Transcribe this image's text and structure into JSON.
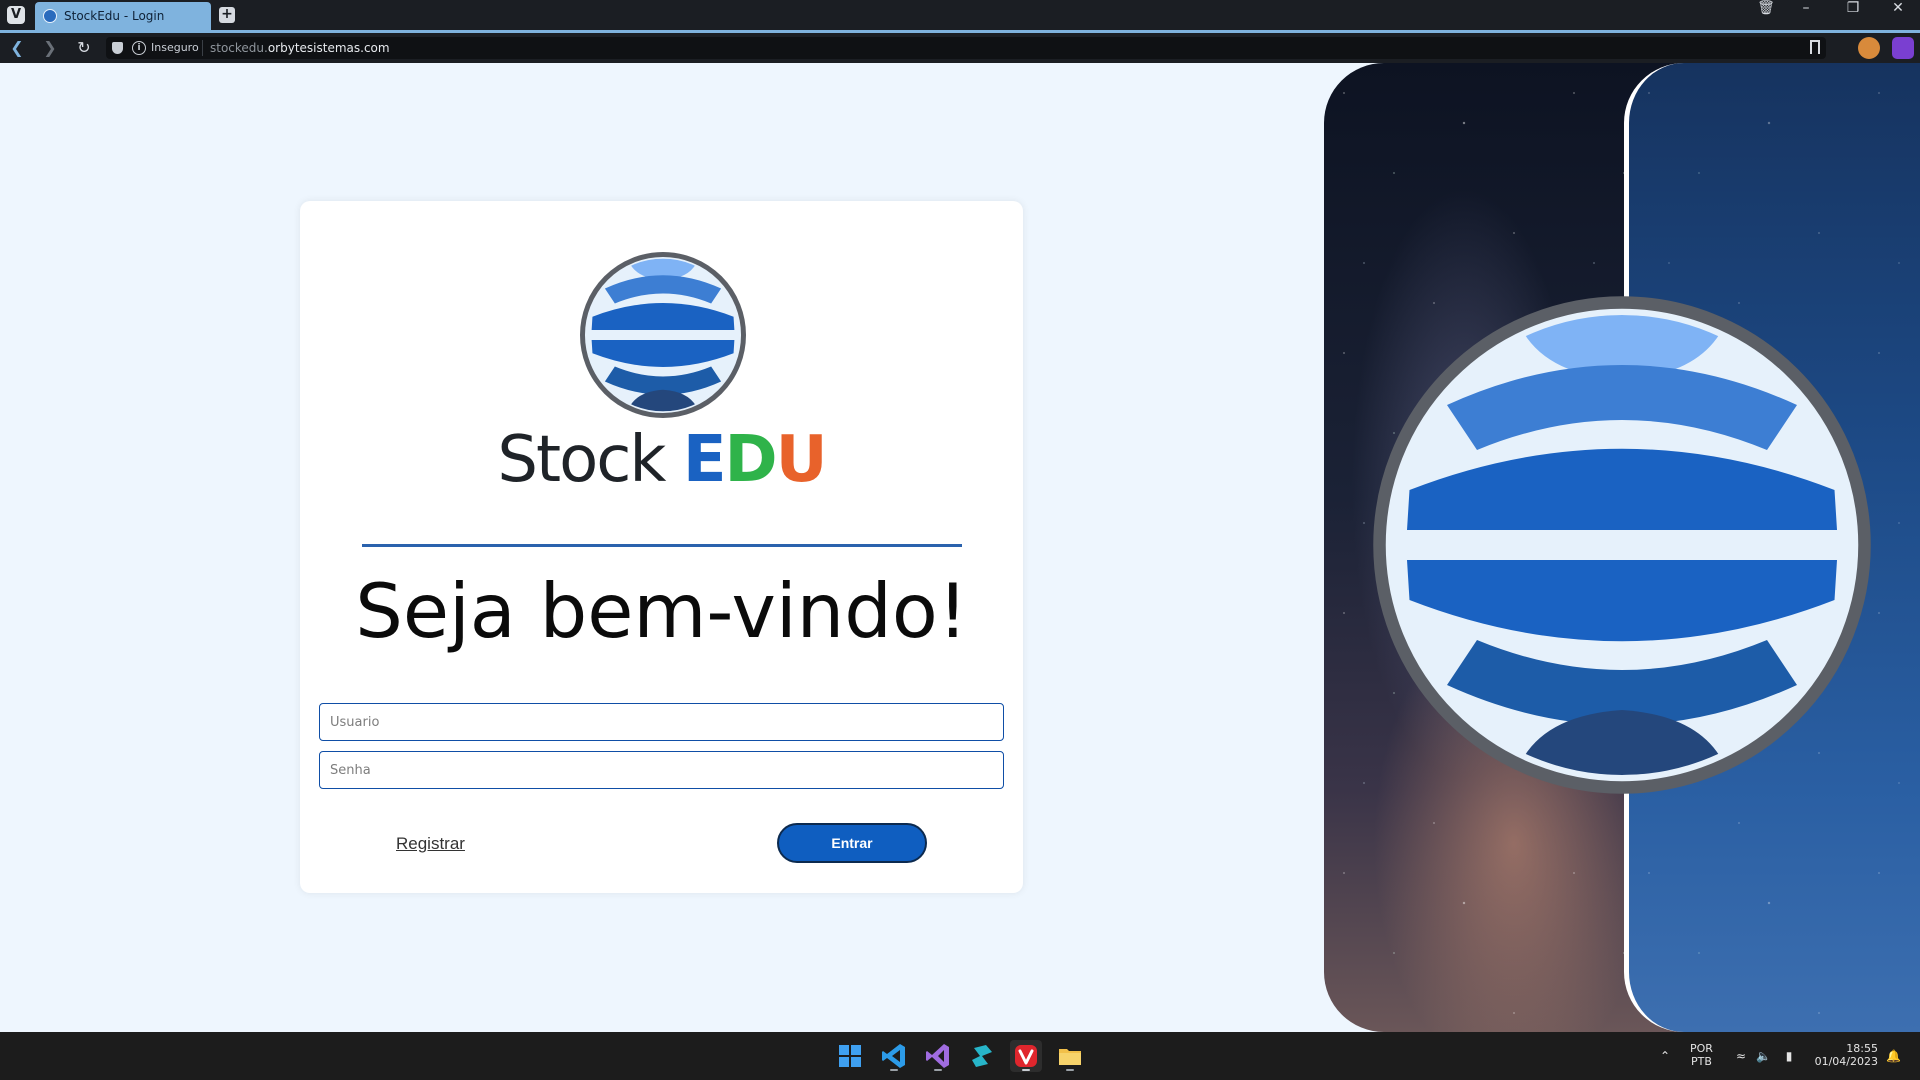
{
  "browser": {
    "tab_title": "StockEdu - Login",
    "security_label": "Inseguro",
    "url_prefix": "stockedu.",
    "url_domain": "orbytesistemas.com"
  },
  "login": {
    "brand_stock": "Stock",
    "brand_e": "E",
    "brand_d": "D",
    "brand_u": "U",
    "welcome": "Seja bem-vindo!",
    "username_placeholder": "Usuario",
    "password_placeholder": "Senha",
    "register_label": "Registrar",
    "submit_label": "Entrar"
  },
  "taskbar": {
    "lang_top": "POR",
    "lang_bottom": "PTB",
    "time": "18:55",
    "date": "01/04/2023"
  },
  "colors": {
    "brand_blue": "#1a62c2",
    "brand_green": "#2fb34a",
    "brand_orange": "#e8622b",
    "button_blue": "#0f5ec0",
    "page_bg": "#eef6fe"
  },
  "icons": [
    "vivaldi-icon",
    "new-tab-icon",
    "trash-icon",
    "minimize-icon",
    "restore-icon",
    "close-icon",
    "back-icon",
    "forward-icon",
    "reload-icon",
    "shield-icon",
    "info-icon",
    "bookmark-icon",
    "globe-logo-icon",
    "windows-start-icon",
    "vscode-icon",
    "visual-studio-icon",
    "app-icon",
    "vivaldi-taskbar-icon",
    "file-explorer-icon",
    "chevron-up-icon",
    "wifi-icon",
    "speaker-icon",
    "battery-icon",
    "notification-icon"
  ]
}
